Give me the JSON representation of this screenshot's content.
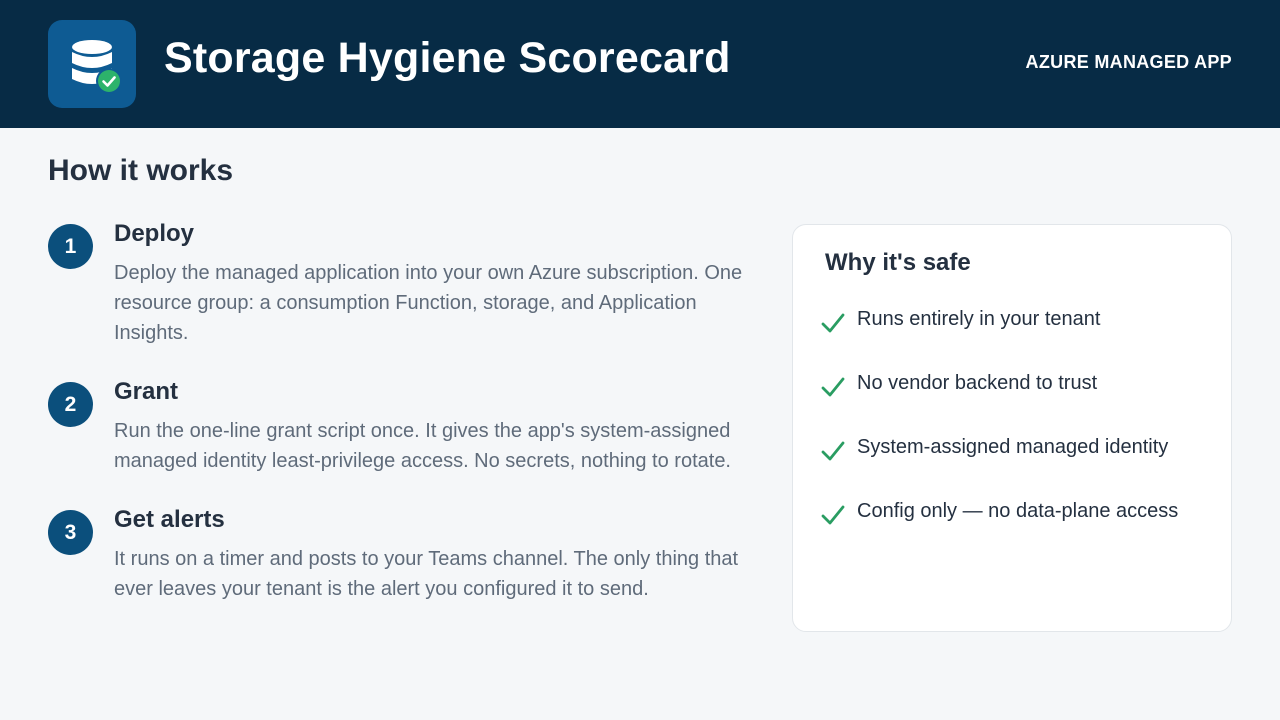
{
  "header": {
    "title": "Storage Hygiene Scorecard",
    "tag": "AZURE MANAGED APP",
    "logo_icon": "database-check-icon",
    "background_color": "#072b45",
    "logo_color": "#0e5b93",
    "check_color": "#2db36b"
  },
  "how_it_works": {
    "title": "How it works",
    "steps": [
      {
        "number": "1",
        "title": "Deploy",
        "description": "Deploy the managed application into your own Azure subscription. One resource group: a consumption Function, storage, and Application Insights."
      },
      {
        "number": "2",
        "title": "Grant",
        "description": "Run the one-line grant script once. It gives the app's system-assigned managed identity least-privilege access. No secrets, nothing to rotate."
      },
      {
        "number": "3",
        "title": "Get alerts",
        "description": "It runs on a timer and posts to your Teams channel. The only thing that ever leaves your tenant is the alert you configured it to send."
      }
    ]
  },
  "why_safe": {
    "title": "Why it's safe",
    "items": [
      "Runs entirely in your tenant",
      "No vendor backend to trust",
      "System-assigned managed identity",
      "Config only — no data-plane access"
    ],
    "check_icon": "checkmark-icon",
    "check_color": "#2a9d62"
  }
}
